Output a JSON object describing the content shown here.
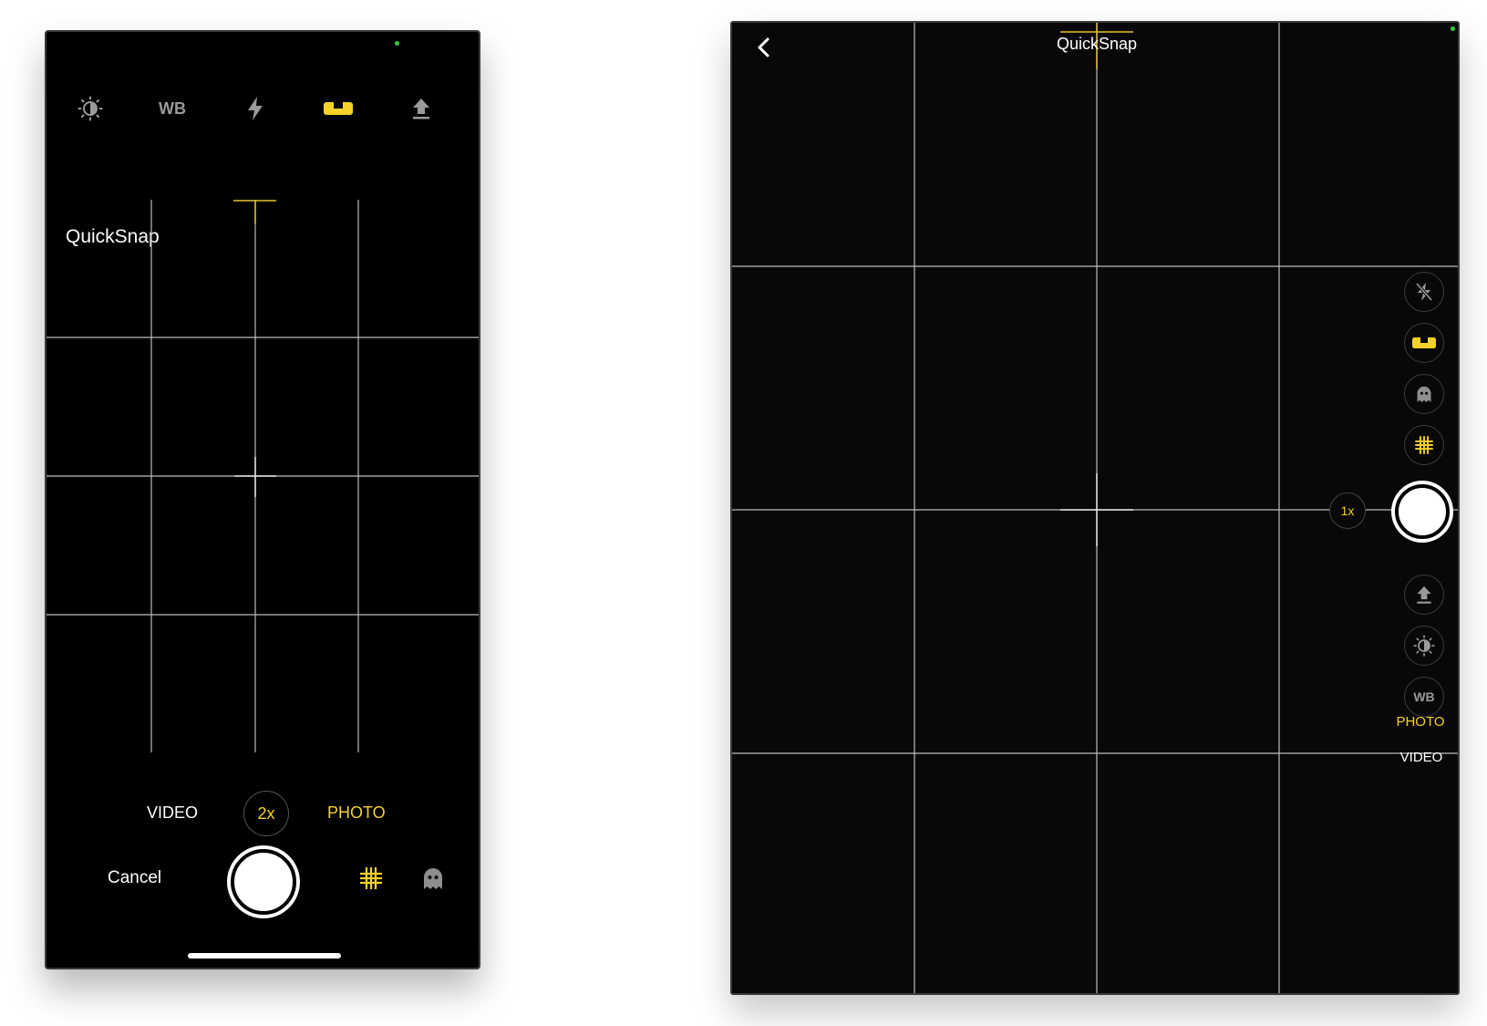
{
  "phone": {
    "title": "QuickSnap",
    "toolbar": {
      "exposure_icon": "exposure-icon",
      "wb_label": "WB",
      "flash_icon": "flash-icon",
      "level_icon": "level-icon",
      "share_icon": "share-icon"
    },
    "modes": {
      "video": "VIDEO",
      "photo": "PHOTO",
      "active": "PHOTO"
    },
    "zoom": "2x",
    "cancel": "Cancel",
    "grid_enabled": true,
    "icons": {
      "grid": "grid-icon",
      "ghost": "ghost-icon"
    }
  },
  "tablet": {
    "title": "QuickSnap",
    "back_icon": "chevron-left-icon",
    "controls": {
      "flash_off_icon": "flash-off-icon",
      "level_icon": "level-icon",
      "ghost_icon": "ghost-icon",
      "grid_icon": "grid-icon",
      "share_icon": "share-icon",
      "exposure_icon": "exposure-icon",
      "wb_label": "WB"
    },
    "zoom": "1x",
    "modes": {
      "photo": "PHOTO",
      "video": "VIDEO",
      "active": "PHOTO"
    }
  },
  "colors": {
    "accent": "#f5d22a",
    "background": "#000000",
    "inactive": "#9a9a9a",
    "status_dot": "#2ecc40"
  }
}
